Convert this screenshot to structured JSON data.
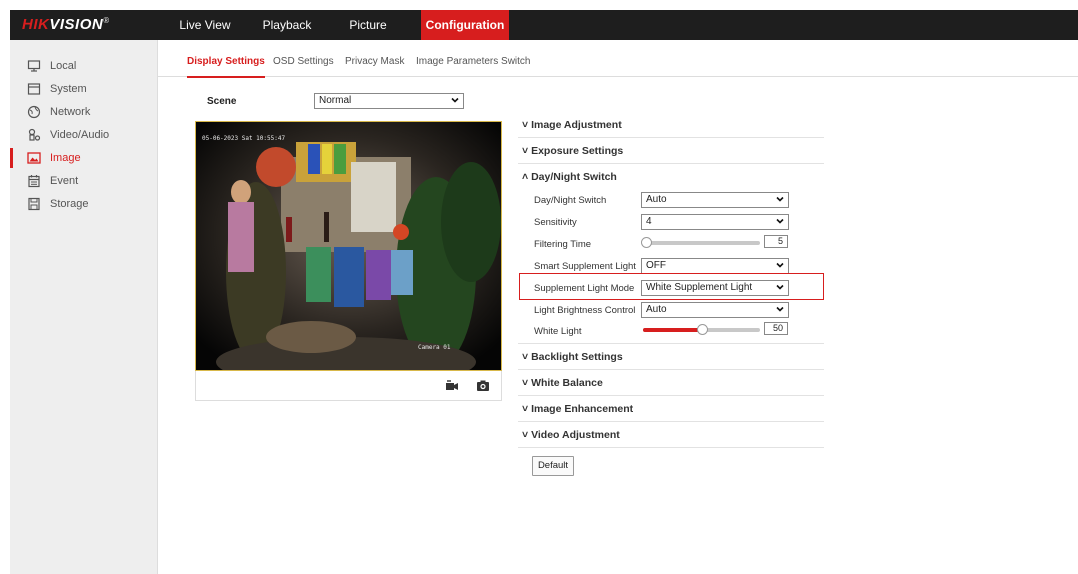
{
  "app": {
    "logo_red": "HIK",
    "logo_white": "VISION",
    "logo_mark": "®"
  },
  "nav": [
    {
      "label": "Live View"
    },
    {
      "label": "Playback"
    },
    {
      "label": "Picture"
    },
    {
      "label": "Configuration"
    }
  ],
  "sidebar": {
    "items": [
      {
        "label": "Local",
        "icon": "monitor-icon"
      },
      {
        "label": "System",
        "icon": "system-icon"
      },
      {
        "label": "Network",
        "icon": "globe-icon"
      },
      {
        "label": "Video/Audio",
        "icon": "video-audio-icon"
      },
      {
        "label": "Image",
        "icon": "image-icon"
      },
      {
        "label": "Event",
        "icon": "calendar-icon"
      },
      {
        "label": "Storage",
        "icon": "storage-icon"
      }
    ]
  },
  "subtabs": [
    {
      "label": "Display Settings"
    },
    {
      "label": "OSD Settings"
    },
    {
      "label": "Privacy Mask"
    },
    {
      "label": "Image Parameters Switch"
    }
  ],
  "scene": {
    "label": "Scene",
    "value": "Normal"
  },
  "video": {
    "timestamp": "05-06-2023 Sat 10:55:47",
    "camera_name": "Camera 01",
    "record_icon": "record-icon",
    "snapshot_icon": "camera-snapshot-icon"
  },
  "sections": {
    "image_adjustment": "Image Adjustment",
    "exposure_settings": "Exposure Settings",
    "day_night_switch": "Day/Night Switch",
    "backlight_settings": "Backlight Settings",
    "white_balance": "White Balance",
    "image_enhancement": "Image Enhancement",
    "video_adjustment": "Video Adjustment"
  },
  "day_night": {
    "switch_label": "Day/Night Switch",
    "switch_value": "Auto",
    "sensitivity_label": "Sensitivity",
    "sensitivity_value": "4",
    "filtering_label": "Filtering Time",
    "filtering_value": "5",
    "filtering_level": 0.0,
    "smart_label": "Smart Supplement Light",
    "smart_value": "OFF",
    "mode_label": "Supplement Light Mode",
    "mode_value": "White Supplement Light",
    "brightness_label": "Light Brightness Control",
    "brightness_value": "Auto",
    "white_label": "White Light",
    "white_value": "50",
    "white_level": 0.5
  },
  "buttons": {
    "default_label": "Default"
  },
  "colors": {
    "brand_red": "#d71e1e",
    "topbar": "#1e1e1e",
    "sidebar": "#eeeeee"
  }
}
